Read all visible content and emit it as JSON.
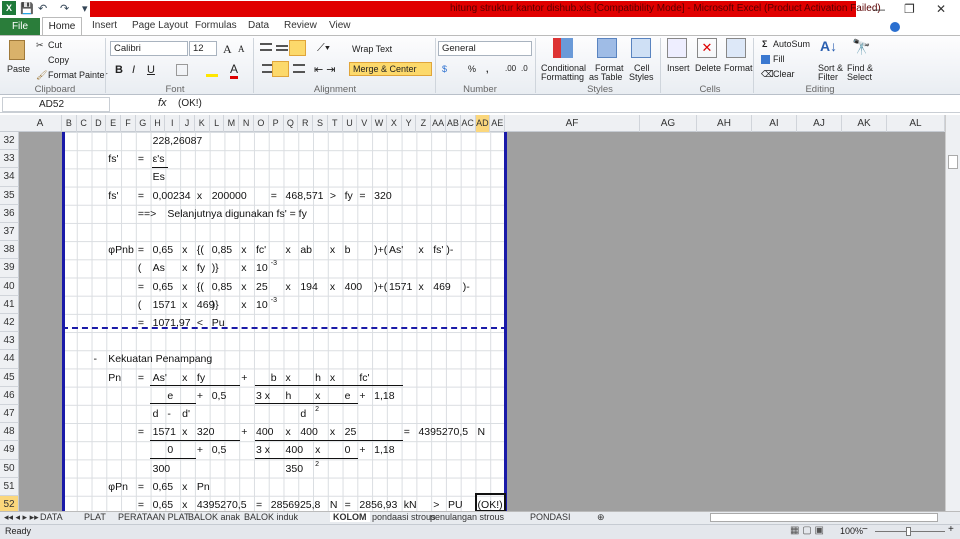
{
  "window": {
    "title": "hitung struktur kantor dishub.xls  [Compatibility Mode]  -  Microsoft Excel (Product Activation Failed)",
    "minimize": "—",
    "restore": "❐",
    "close": "✕"
  },
  "quick_access": {
    "save": "💾",
    "undo": "↶",
    "redo": "↷",
    "customize": "▾"
  },
  "ribbon_tabs": [
    "File",
    "Home",
    "Insert",
    "Page Layout",
    "Formulas",
    "Data",
    "Review",
    "View"
  ],
  "clipboard": {
    "paste": "Paste",
    "cut": "Cut",
    "copy": "Copy",
    "format_painter": "Format Painter",
    "label": "Clipboard"
  },
  "font": {
    "name": "Calibri",
    "size": "12",
    "bold": "B",
    "italic": "I",
    "underline": "U",
    "label": "Font",
    "grow": "A",
    "shrink": "A",
    "color": "A"
  },
  "alignment": {
    "wrap": "Wrap Text",
    "merge": "Merge & Center",
    "label": "Alignment"
  },
  "number": {
    "format": "General",
    "percent": "%",
    "comma": ",",
    "inc": ".00",
    "dec": ".0",
    "label": "Number",
    "currency": "$"
  },
  "styles": {
    "conditional": "Conditional",
    "conditional2": "Formatting",
    "format_table": "Format",
    "format_table2": "as Table",
    "cell_styles": "Cell",
    "cell_styles2": "Styles",
    "label": "Styles"
  },
  "cells": {
    "insert": "Insert",
    "delete": "Delete",
    "format": "Format",
    "label": "Cells"
  },
  "editing": {
    "autosum": "AutoSum",
    "fill": "Fill",
    "clear": "Clear",
    "sort": "Sort &",
    "sort2": "Filter",
    "find": "Find &",
    "find2": "Select",
    "label": "Editing"
  },
  "formula_bar": {
    "name_box": "AD52",
    "fx": "fx",
    "value": "(OK!)"
  },
  "columns": [
    "A",
    "B",
    "C",
    "D",
    "E",
    "F",
    "G",
    "H",
    "I",
    "J",
    "K",
    "L",
    "M",
    "N",
    "O",
    "P",
    "Q",
    "R",
    "S",
    "T",
    "U",
    "V",
    "W",
    "X",
    "Y",
    "Z",
    "AA",
    "AB",
    "AC",
    "AD",
    "AE",
    "AF",
    "AG",
    "AH",
    "AI",
    "AJ",
    "AK",
    "AL"
  ],
  "selected_cell": {
    "col": "AD",
    "row": 52
  },
  "rows": [
    {
      "n": 32,
      "cells": [
        {
          "c": "H",
          "t": "228,26087"
        }
      ]
    },
    {
      "n": 33,
      "cells": [
        {
          "c": "E",
          "t": "fs'"
        },
        {
          "c": "G",
          "t": "="
        },
        {
          "c": "H",
          "t": "ε's"
        }
      ]
    },
    {
      "n": 34,
      "cells": [
        {
          "c": "H",
          "t": "Es"
        }
      ]
    },
    {
      "n": 35,
      "cells": [
        {
          "c": "E",
          "t": "fs'"
        },
        {
          "c": "G",
          "t": "="
        },
        {
          "c": "H",
          "t": "0,00234"
        },
        {
          "c": "K",
          "t": "x"
        },
        {
          "c": "L",
          "t": "200000"
        },
        {
          "c": "P",
          "t": "="
        },
        {
          "c": "Q",
          "t": "468,571"
        },
        {
          "c": "T",
          "t": ">"
        },
        {
          "c": "U",
          "t": "fy"
        },
        {
          "c": "V",
          "t": "="
        },
        {
          "c": "W",
          "t": "320"
        }
      ]
    },
    {
      "n": 36,
      "cells": [
        {
          "c": "G",
          "t": "==>"
        },
        {
          "c": "I",
          "t": "Selanjutnya digunakan fs' = fy"
        }
      ]
    },
    {
      "n": 37,
      "cells": []
    },
    {
      "n": 38,
      "cells": [
        {
          "c": "E",
          "t": "φPnb"
        },
        {
          "c": "G",
          "t": "="
        },
        {
          "c": "H",
          "t": "0,65"
        },
        {
          "c": "J",
          "t": "x"
        },
        {
          "c": "K",
          "t": "{("
        },
        {
          "c": "L",
          "t": "0,85"
        },
        {
          "c": "N",
          "t": "x"
        },
        {
          "c": "O",
          "t": "fc'"
        },
        {
          "c": "Q",
          "t": "x"
        },
        {
          "c": "R",
          "t": "ab"
        },
        {
          "c": "T",
          "t": "x"
        },
        {
          "c": "U",
          "t": "b"
        },
        {
          "c": "W",
          "t": ")+("
        },
        {
          "c": "X",
          "t": "As'"
        },
        {
          "c": "Z",
          "t": "x"
        },
        {
          "c": "AA",
          "t": "fs' )-"
        }
      ]
    },
    {
      "n": 39,
      "cells": [
        {
          "c": "G",
          "t": "("
        },
        {
          "c": "H",
          "t": "As"
        },
        {
          "c": "J",
          "t": "x"
        },
        {
          "c": "K",
          "t": "fy"
        },
        {
          "c": "L",
          "t": ")}"
        },
        {
          "c": "N",
          "t": "x"
        },
        {
          "c": "O",
          "t": "10"
        },
        {
          "c": "P",
          "t": "-3",
          "sup": true
        }
      ]
    },
    {
      "n": 40,
      "cells": [
        {
          "c": "G",
          "t": "="
        },
        {
          "c": "H",
          "t": "0,65"
        },
        {
          "c": "J",
          "t": "x"
        },
        {
          "c": "K",
          "t": "{("
        },
        {
          "c": "L",
          "t": "0,85"
        },
        {
          "c": "N",
          "t": "x"
        },
        {
          "c": "O",
          "t": "25"
        },
        {
          "c": "Q",
          "t": "x"
        },
        {
          "c": "R",
          "t": "194"
        },
        {
          "c": "T",
          "t": "x"
        },
        {
          "c": "U",
          "t": "400"
        },
        {
          "c": "W",
          "t": ")+("
        },
        {
          "c": "X",
          "t": "1571"
        },
        {
          "c": "Z",
          "t": "x"
        },
        {
          "c": "AA",
          "t": "469"
        },
        {
          "c": "AC",
          "t": ")-"
        }
      ]
    },
    {
      "n": 41,
      "cells": [
        {
          "c": "G",
          "t": "("
        },
        {
          "c": "H",
          "t": "1571"
        },
        {
          "c": "J",
          "t": "x"
        },
        {
          "c": "K",
          "t": "469"
        },
        {
          "c": "L",
          "t": ")}"
        },
        {
          "c": "N",
          "t": "x"
        },
        {
          "c": "O",
          "t": "10"
        },
        {
          "c": "P",
          "t": "-3",
          "sup": true
        }
      ]
    },
    {
      "n": 42,
      "cells": [
        {
          "c": "G",
          "t": "="
        },
        {
          "c": "H",
          "t": "1071,97"
        },
        {
          "c": "K",
          "t": "<"
        },
        {
          "c": "L",
          "t": "Pu"
        }
      ]
    },
    {
      "n": 43,
      "cells": []
    },
    {
      "n": 44,
      "cells": [
        {
          "c": "D",
          "t": "-"
        },
        {
          "c": "E",
          "t": "Kekuatan Penampang"
        }
      ]
    },
    {
      "n": 45,
      "cells": [
        {
          "c": "E",
          "t": "Pn"
        },
        {
          "c": "G",
          "t": "="
        },
        {
          "c": "H",
          "t": "As'"
        },
        {
          "c": "J",
          "t": "x"
        },
        {
          "c": "K",
          "t": "fy"
        },
        {
          "c": "N",
          "t": "+"
        },
        {
          "c": "P",
          "t": "b"
        },
        {
          "c": "Q",
          "t": "x"
        },
        {
          "c": "S",
          "t": "h"
        },
        {
          "c": "T",
          "t": "x"
        },
        {
          "c": "V",
          "t": "fc'"
        }
      ]
    },
    {
      "n": 46,
      "cells": [
        {
          "c": "I",
          "t": "e"
        },
        {
          "c": "K",
          "t": "+"
        },
        {
          "c": "L",
          "t": "0,5"
        },
        {
          "c": "O",
          "t": "3  x"
        },
        {
          "c": "Q",
          "t": "h"
        },
        {
          "c": "S",
          "t": "x"
        },
        {
          "c": "U",
          "t": "e"
        },
        {
          "c": "V",
          "t": "+"
        },
        {
          "c": "W",
          "t": "1,18"
        }
      ]
    },
    {
      "n": 47,
      "cells": [
        {
          "c": "H",
          "t": "d"
        },
        {
          "c": "I",
          "t": "-"
        },
        {
          "c": "J",
          "t": "d'"
        },
        {
          "c": "R",
          "t": "d"
        },
        {
          "c": "S",
          "t": "2",
          "sup": true
        }
      ]
    },
    {
      "n": 48,
      "cells": [
        {
          "c": "G",
          "t": "="
        },
        {
          "c": "H",
          "t": "1571"
        },
        {
          "c": "J",
          "t": "x"
        },
        {
          "c": "K",
          "t": "320"
        },
        {
          "c": "N",
          "t": "+"
        },
        {
          "c": "O",
          "t": "400"
        },
        {
          "c": "Q",
          "t": "x"
        },
        {
          "c": "R",
          "t": "400"
        },
        {
          "c": "T",
          "t": "x"
        },
        {
          "c": "U",
          "t": "25"
        },
        {
          "c": "Y",
          "t": "="
        },
        {
          "c": "Z",
          "t": "4395270,5"
        },
        {
          "c": "AD",
          "t": "N"
        }
      ]
    },
    {
      "n": 49,
      "cells": [
        {
          "c": "I",
          "t": "0"
        },
        {
          "c": "K",
          "t": "+"
        },
        {
          "c": "L",
          "t": "0,5"
        },
        {
          "c": "O",
          "t": "3 x"
        },
        {
          "c": "Q",
          "t": "400"
        },
        {
          "c": "S",
          "t": "x"
        },
        {
          "c": "U",
          "t": "0"
        },
        {
          "c": "V",
          "t": "+"
        },
        {
          "c": "W",
          "t": "1,18"
        }
      ]
    },
    {
      "n": 50,
      "cells": [
        {
          "c": "H",
          "t": "300"
        },
        {
          "c": "Q",
          "t": "350"
        },
        {
          "c": "S",
          "t": "2",
          "sup": true
        }
      ]
    },
    {
      "n": 51,
      "cells": [
        {
          "c": "E",
          "t": "φPn"
        },
        {
          "c": "G",
          "t": "="
        },
        {
          "c": "H",
          "t": "0,65"
        },
        {
          "c": "J",
          "t": "x"
        },
        {
          "c": "K",
          "t": "Pn"
        }
      ]
    },
    {
      "n": 52,
      "cells": [
        {
          "c": "G",
          "t": "="
        },
        {
          "c": "H",
          "t": "0,65"
        },
        {
          "c": "J",
          "t": "x"
        },
        {
          "c": "K",
          "t": "4395270,5"
        },
        {
          "c": "O",
          "t": "="
        },
        {
          "c": "P",
          "t": "2856925,8"
        },
        {
          "c": "T",
          "t": "N"
        },
        {
          "c": "U",
          "t": "="
        },
        {
          "c": "V",
          "t": "2856,93"
        },
        {
          "c": "Y",
          "t": "kN"
        },
        {
          "c": "AA",
          "t": ">"
        },
        {
          "c": "AB",
          "t": "PU"
        },
        {
          "c": "AD",
          "t": "(OK!)"
        }
      ]
    }
  ],
  "sheet_tabs": [
    "DATA",
    "PLAT",
    "PERATAAN PLAT",
    "BALOK anak",
    "BALOK induk",
    "KOLOM",
    "pondaasi strous",
    "penulangan strous",
    "PONDASI"
  ],
  "active_sheet": "KOLOM",
  "status": {
    "ready": "Ready",
    "zoom": "100%",
    "minus": "−",
    "plus": "+"
  }
}
